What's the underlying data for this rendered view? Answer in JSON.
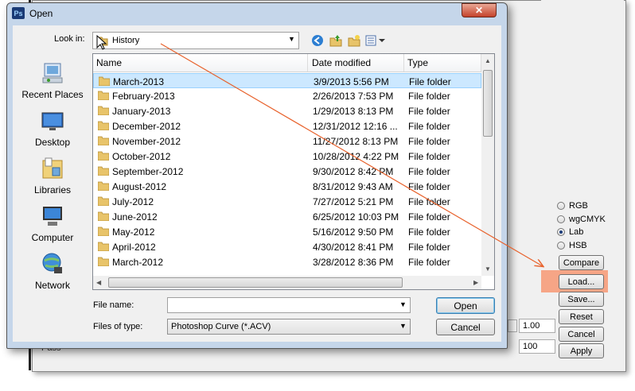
{
  "dialog": {
    "title": "Open",
    "app_icon_text": "Ps",
    "close_label": "✕",
    "look_in_label": "Look in:",
    "look_in_value": "History",
    "places": [
      "Recent Places",
      "Desktop",
      "Libraries",
      "Computer",
      "Network"
    ],
    "columns": [
      "Name",
      "Date modified",
      "Type"
    ],
    "files": [
      {
        "name": "March-2013",
        "date": "3/9/2013 5:56 PM",
        "type": "File folder"
      },
      {
        "name": "February-2013",
        "date": "2/26/2013 7:53 PM",
        "type": "File folder"
      },
      {
        "name": "January-2013",
        "date": "1/29/2013 8:13 PM",
        "type": "File folder"
      },
      {
        "name": "December-2012",
        "date": "12/31/2012 12:16 ...",
        "type": "File folder"
      },
      {
        "name": "November-2012",
        "date": "11/27/2012 8:13 PM",
        "type": "File folder"
      },
      {
        "name": "October-2012",
        "date": "10/28/2012 4:22 PM",
        "type": "File folder"
      },
      {
        "name": "September-2012",
        "date": "9/30/2012 8:42 PM",
        "type": "File folder"
      },
      {
        "name": "August-2012",
        "date": "8/31/2012 9:43 AM",
        "type": "File folder"
      },
      {
        "name": "July-2012",
        "date": "7/27/2012 5:21 PM",
        "type": "File folder"
      },
      {
        "name": "June-2012",
        "date": "6/25/2012 10:03 PM",
        "type": "File folder"
      },
      {
        "name": "May-2012",
        "date": "5/16/2012 9:50 PM",
        "type": "File folder"
      },
      {
        "name": "April-2012",
        "date": "4/30/2012 8:41 PM",
        "type": "File folder"
      },
      {
        "name": "March-2012",
        "date": "3/28/2012 8:36 PM",
        "type": "File folder"
      }
    ],
    "selected_index": 0,
    "file_name_label": "File name:",
    "file_name_value": "",
    "files_of_type_label": "Files of type:",
    "files_of_type_value": "Photoshop Curve (*.ACV)",
    "open_label": "Open",
    "cancel_label": "Cancel"
  },
  "panel": {
    "color_modes": [
      "RGB",
      "wgCMYK",
      "Lab",
      "HSB"
    ],
    "selected_mode": "Lab",
    "buttons": [
      "Compare",
      "Load...",
      "Save...",
      "Reset",
      "Cancel",
      "Apply"
    ],
    "highlighted_button": "Load...",
    "value_1": "1.00",
    "value_2": "100",
    "behind_label": "Pass"
  },
  "colors": {
    "highlight": "#f6a586",
    "annotation_arrow": "#e8622c",
    "selection": "#cce8ff",
    "magenta_swatch": "#e000e0"
  }
}
